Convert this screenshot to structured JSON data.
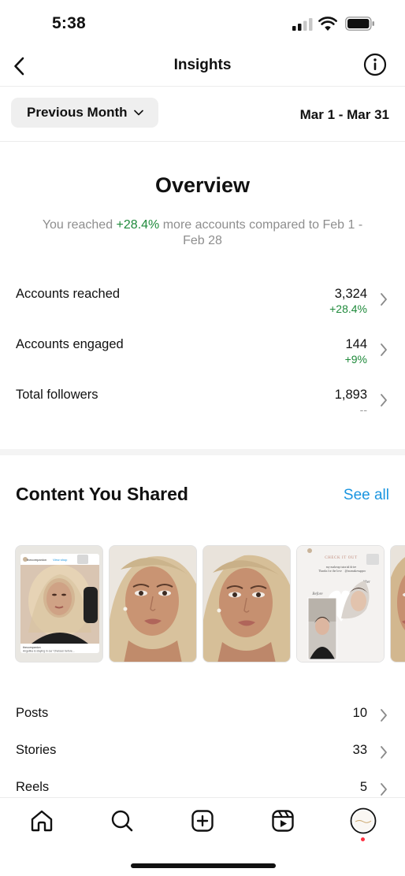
{
  "status": {
    "time": "5:38"
  },
  "nav": {
    "title": "Insights"
  },
  "filter": {
    "period": "Previous Month",
    "date_range": "Mar 1 - Mar 31"
  },
  "overview": {
    "title": "Overview",
    "desc_prefix": "You reached ",
    "desc_highlight": "+28.4%",
    "desc_suffix": " more accounts compared to Feb 1 - Feb 28"
  },
  "metrics": [
    {
      "label": "Accounts reached",
      "value": "3,324",
      "delta": "+28.4%"
    },
    {
      "label": "Accounts engaged",
      "value": "144",
      "delta": "+9%"
    },
    {
      "label": "Total followers",
      "value": "1,893",
      "delta": "--"
    }
  ],
  "content": {
    "title": "Content You Shared",
    "see_all": "See all",
    "thumbnails": [
      {
        "kind": "shared-post-story",
        "post_username": "thecompanion",
        "post_link": "View shop",
        "post_caption_user": "thecompanion",
        "post_caption": "Angelika is staying in our 'Chelsea' before..."
      },
      {
        "kind": "portrait"
      },
      {
        "kind": "portrait"
      },
      {
        "kind": "before-after-story",
        "header": "CHECK IT OUT",
        "caption_line1": "my makeup tutorial drive",
        "caption_line2": "Thanks for the love",
        "handle": "@mamakesuppro",
        "before_label": "Before",
        "after_label": "After"
      },
      {
        "kind": "portrait"
      }
    ]
  },
  "counts": [
    {
      "label": "Posts",
      "value": "10"
    },
    {
      "label": "Stories",
      "value": "33"
    },
    {
      "label": "Reels",
      "value": "5"
    }
  ],
  "tabbar": {
    "items": [
      "home-icon",
      "search-icon",
      "create-icon",
      "reels-icon",
      "profile-avatar"
    ],
    "notification_dot_color": "#ff3040"
  },
  "colors": {
    "accent_link": "#1a95e0",
    "positive": "#1f8a3b",
    "muted": "#8e8e8e"
  }
}
